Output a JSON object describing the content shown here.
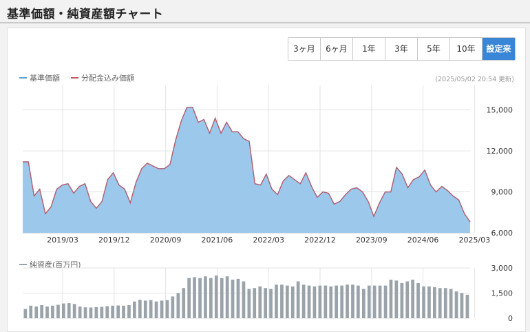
{
  "header": {
    "title": "基準価額・純資産額チャート"
  },
  "periods": [
    {
      "label": "3ヶ月",
      "active": false
    },
    {
      "label": "6ヶ月",
      "active": false
    },
    {
      "label": "1年",
      "active": false
    },
    {
      "label": "3年",
      "active": false
    },
    {
      "label": "5年",
      "active": false
    },
    {
      "label": "10年",
      "active": false
    },
    {
      "label": "設定来",
      "active": true
    }
  ],
  "legend": {
    "nav": "基準価額",
    "dividend": "分配金込み価額",
    "net_assets": "純資産(百万円)"
  },
  "updated": "(2025/05/02 20:54 更新)",
  "colors": {
    "nav_line": "#5aa2d9",
    "nav_fill": "#9cc8eb",
    "dividend_line": "#c8575f",
    "bars": "#9aa3aa",
    "active_button": "#3a86d6"
  },
  "chart_data": [
    {
      "type": "area",
      "x_ticks": [
        "2019/03",
        "2019/12",
        "2020/09",
        "2021/06",
        "2022/03",
        "2022/12",
        "2023/09",
        "2024/06",
        "2025/03"
      ],
      "y_ticks": [
        "6,000",
        "9,000",
        "12,000",
        "15,000"
      ],
      "ylim": [
        6000,
        16800
      ],
      "grid": true,
      "series": [
        {
          "name": "基準価額",
          "values": [
            11200,
            11200,
            8700,
            9200,
            7400,
            7900,
            9200,
            9500,
            9600,
            8900,
            9400,
            9600,
            8300,
            7800,
            8300,
            9900,
            10400,
            9500,
            9200,
            8200,
            9700,
            10700,
            11100,
            10900,
            10700,
            10700,
            11000,
            12800,
            14200,
            15200,
            15200,
            14100,
            14300,
            13300,
            14400,
            13300,
            14100,
            13400,
            13400,
            12900,
            12700,
            9600,
            9500,
            10300,
            9200,
            8800,
            9800,
            10200,
            9900,
            9600,
            10400,
            9400,
            8600,
            9000,
            8900,
            8100,
            8300,
            8800,
            9200,
            9300,
            9000,
            8300,
            7200,
            8200,
            9000,
            9000,
            10800,
            10300,
            9300,
            9900,
            10100,
            10600,
            9500,
            9000,
            9400,
            9100,
            8700,
            8400,
            7400,
            6800
          ]
        },
        {
          "name": "分配金込み価額",
          "values": [
            11200,
            11200,
            8700,
            9200,
            7400,
            7900,
            9200,
            9500,
            9600,
            8900,
            9400,
            9600,
            8300,
            7800,
            8300,
            9900,
            10400,
            9500,
            9200,
            8200,
            9700,
            10700,
            11100,
            10900,
            10700,
            10700,
            11000,
            12800,
            14200,
            15200,
            15200,
            14100,
            14300,
            13300,
            14400,
            13300,
            14100,
            13400,
            13400,
            12900,
            12700,
            9600,
            9500,
            10300,
            9200,
            8800,
            9800,
            10200,
            9900,
            9600,
            10400,
            9400,
            8600,
            9000,
            8900,
            8100,
            8300,
            8800,
            9200,
            9300,
            9000,
            8300,
            7200,
            8200,
            9000,
            9000,
            10800,
            10300,
            9300,
            9900,
            10100,
            10600,
            9500,
            9000,
            9400,
            9100,
            8700,
            8400,
            7400,
            6800
          ]
        }
      ]
    },
    {
      "type": "bar",
      "y_ticks": [
        "0",
        "1,500",
        "3,000"
      ],
      "ylim": [
        0,
        3000
      ],
      "series": [
        {
          "name": "純資産(百万円)",
          "values": [
            550,
            750,
            700,
            780,
            700,
            750,
            800,
            880,
            900,
            850,
            700,
            650,
            640,
            660,
            680,
            720,
            750,
            760,
            750,
            780,
            1000,
            1100,
            1050,
            1080,
            1000,
            1050,
            1080,
            1300,
            1500,
            1800,
            2400,
            2450,
            2400,
            2500,
            2400,
            2550,
            2400,
            2500,
            2300,
            2350,
            2200,
            1750,
            1800,
            1900,
            1800,
            1750,
            2000,
            2000,
            1950,
            1900,
            2200,
            2000,
            1950,
            1900,
            1950,
            1950,
            1900,
            1950,
            1950,
            2000,
            2000,
            1950,
            1750,
            1950,
            1950,
            1950,
            1950,
            2300,
            2250,
            2100,
            2200,
            2300,
            2100,
            1900,
            1900,
            1850,
            1800,
            1800,
            1750,
            1600,
            1500,
            1400
          ]
        }
      ]
    }
  ]
}
